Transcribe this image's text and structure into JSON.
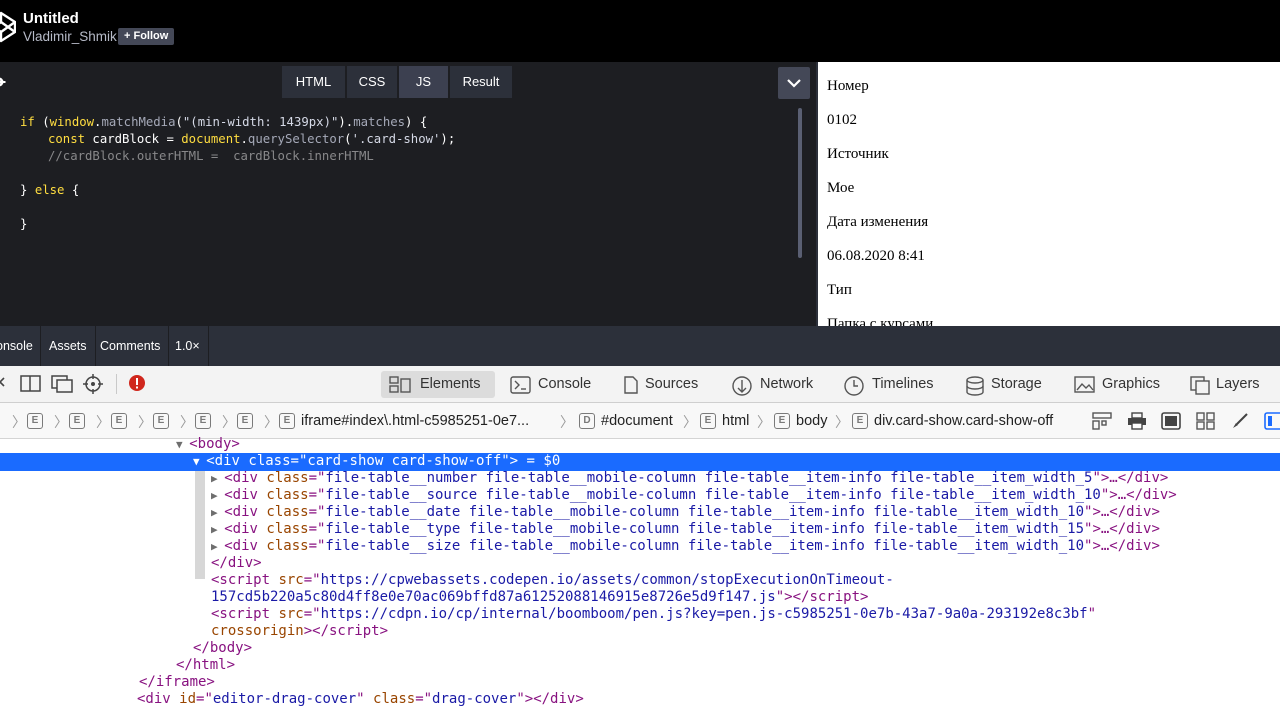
{
  "header": {
    "title": "Untitled",
    "user": "Vladimir_Shmik",
    "follow_label": "+ Follow"
  },
  "editor": {
    "tabs": [
      "HTML",
      "CSS",
      "JS",
      "Result"
    ],
    "active_tab": "JS",
    "code": {
      "l1_kw_if": "if",
      "l1_paren": " (",
      "l1_obj": "window",
      "l1_dot": ".",
      "l1_fn": "matchMedia",
      "l1_open": "(",
      "l1_str": "\"(min-width: 1439px)\"",
      "l1_close": ").",
      "l1_prop": "matches",
      "l1_end": ") {",
      "l2_kw": "const",
      "l2_var": " cardBlock = ",
      "l2_obj": "document",
      "l2_dot": ".",
      "l2_fn": "querySelector",
      "l2_open": "(",
      "l2_str": "'.card-show'",
      "l2_end": ");",
      "l3_comment": "//cardBlock.outerHTML =  cardBlock.innerHTML",
      "l5_close": "} ",
      "l5_else": "else",
      "l5_open": " {",
      "l7_close": "}"
    }
  },
  "result": {
    "lines": [
      "Номер",
      "0102",
      "Источник",
      "Мое",
      "Дата изменения",
      "06.08.2020 8:41",
      "Тип",
      "Папка с курсами"
    ]
  },
  "console_bar": {
    "tabs": [
      "Console",
      "Assets",
      "Comments",
      "1.0×"
    ]
  },
  "devtools": {
    "tabs": [
      "Elements",
      "Console",
      "Sources",
      "Network",
      "Timelines",
      "Storage",
      "Graphics",
      "Layers"
    ],
    "active_tab": "Elements",
    "breadcrumb": {
      "e_letter": "E",
      "d_letter": "D",
      "iframe": "iframe#index\\.html-c5985251-0e7...",
      "document": "#document",
      "html": "html",
      "body": "body",
      "div": "div.card-show.card-show-off"
    },
    "dom": {
      "body_open": "<body>",
      "selected_tag": "<div class=\"card-show card-show-off\">",
      "selected_suffix": " = $0",
      "children": [
        "file-table__number file-table__mobile-column file-table__item-info file-table__item_width_5",
        "file-table__source file-table__mobile-column file-table__item-info file-table__item_width_10",
        "file-table__date file-table__mobile-column file-table__item-info file-table__item_width_10",
        "file-table__type file-table__mobile-column file-table__item-info file-table__item_width_15",
        "file-table__size file-table__mobile-column file-table__item-info file-table__item_width_10"
      ],
      "ellipsis_close": "…</div>",
      "div_close": "</div>",
      "script1_src_a": "https://cpwebassets.codepen.io/assets/common/stopExecutionOnTimeout-",
      "script1_src_b": "157cd5b220a5c80d4ff8e0e70ac069bffd87a61252088146915e8726e5d9f147.js",
      "script2_src": "https://cdpn.io/cp/internal/boomboom/pen.js?key=pen.js-c5985251-0e7b-43a7-9a0a-293192e8c3bf",
      "script2_attr": "crossorigin",
      "body_close": "</body>",
      "html_close": "</html>",
      "iframe_close": "</iframe>",
      "drag_cover_id": "editor-drag-cover",
      "drag_cover_class": "drag-cover"
    }
  },
  "colors": {
    "editor_bg": "#1d1e22",
    "selection": "#1a6bff",
    "error_red": "#d0271d"
  }
}
